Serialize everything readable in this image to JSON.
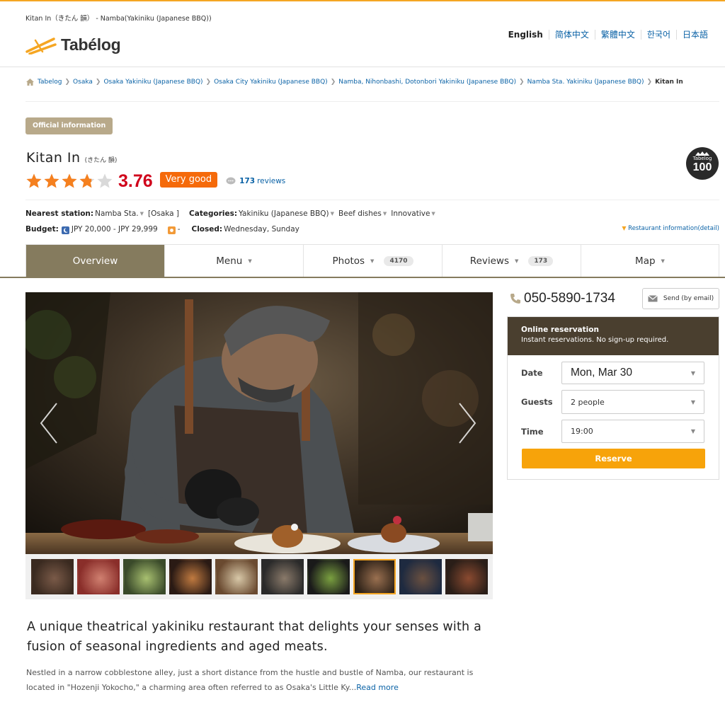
{
  "header": {
    "page_heading": "Kitan In（きたん 韻） - Namba(Yakiniku (Japanese BBQ))",
    "logo_text": "Tabélog",
    "languages": [
      "English",
      "简体中文",
      "繁體中文",
      "한국어",
      "日本語"
    ]
  },
  "breadcrumb": {
    "items": [
      "Tabelog",
      "Osaka",
      "Osaka Yakiniku (Japanese BBQ)",
      "Osaka City Yakiniku (Japanese BBQ)",
      "Namba, Nihonbashi, Dotonbori Yakiniku (Japanese BBQ)",
      "Namba Sta. Yakiniku (Japanese BBQ)"
    ],
    "current": "Kitan In"
  },
  "restaurant": {
    "official_badge": "Official information",
    "name": "Kitan In",
    "name_sub": "(きたん 韻)",
    "rating_stars": 3.76,
    "score": "3.76",
    "rating_label": "Very good",
    "review_count": "173",
    "review_suffix": "reviews",
    "badge_top": "Tabelog",
    "badge_num": "100",
    "nearest_station_label": "Nearest station:",
    "nearest_station": "Namba Sta.",
    "station_area": "[Osaka ]",
    "categories_label": "Categories:",
    "categories": [
      "Yakiniku (Japanese BBQ)",
      "Beef dishes",
      "Innovative"
    ],
    "budget_label": "Budget:",
    "budget_dinner": "JPY 20,000 - JPY 29,999",
    "budget_lunch": "-",
    "closed_label": "Closed:",
    "closed": "Wednesday, Sunday",
    "detail_link": "Restaurant information(detail)"
  },
  "tabs": [
    {
      "label": "Overview",
      "count": ""
    },
    {
      "label": "Menu",
      "count": ""
    },
    {
      "label": "Photos",
      "count": "4170"
    },
    {
      "label": "Reviews",
      "count": "173"
    },
    {
      "label": "Map",
      "count": ""
    }
  ],
  "content": {
    "tagline": "A unique theatrical yakiniku restaurant that delights your senses with a fusion of seasonal ingredients and aged meats.",
    "description": "Nestled in a narrow cobblestone alley, just a short distance from the hustle and bustle of Namba, our restaurant is located in \"Hozenji Yokocho,\" a charming area often referred to as Osaka's Little Ky...",
    "read_more": "Read more"
  },
  "sidebar": {
    "phone": "050-5890-1734",
    "send_label": "Send (by email)",
    "reservation_title": "Online reservation",
    "reservation_sub": "Instant reservations. No sign-up required.",
    "date_label": "Date",
    "date_value": "Mon, Mar 30",
    "guests_label": "Guests",
    "guests_value": "2 people",
    "time_label": "Time",
    "time_value": "19:00",
    "reserve_label": "Reserve"
  },
  "colors": {
    "accent_orange": "#f5a623",
    "score_red": "#d0021b",
    "tab_active": "#857b5e",
    "link_blue": "#0a62a6",
    "reserve_orange": "#f7a30a"
  }
}
